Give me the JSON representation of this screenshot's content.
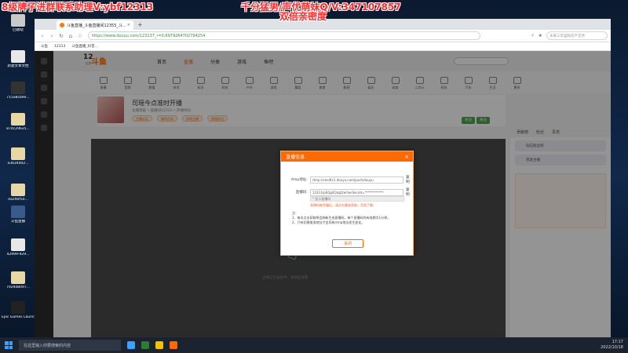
{
  "overlay": {
    "left_banner": "8级牌子进群联系助理V:ybf12313",
    "right_banner_line1": "千分猛男/声优萌妹Q/V:347107857",
    "right_banner_line2": "双倍亲密度"
  },
  "desktop": {
    "icons": [
      {
        "label": "回收站",
        "color": "#c9c9c9"
      },
      {
        "label": "GeForce Expe...",
        "color": "#6bb82c"
      },
      {
        "label": "新建文本文档",
        "color": "#e8e8e8"
      },
      {
        "label": "715a8cb9e...",
        "color": "#333333"
      },
      {
        "label": "874c29635...",
        "color": "#e7d7a6"
      },
      {
        "label": "a3634dd2...",
        "color": "#e7d7a6"
      },
      {
        "label": "ea29ef5e...",
        "color": "#e7d7a6"
      },
      {
        "label": "斗鱼直播",
        "color": "#3a5a8c"
      },
      {
        "label": "42999-929...",
        "color": "#e8e8e8"
      },
      {
        "label": "7929d8097...",
        "color": "#e7d7a6"
      },
      {
        "label": "Epic Games Launcher",
        "color": "#222222"
      }
    ]
  },
  "browser": {
    "tab_title": "斗鱼直播_斗鱼直播间12355_斗...",
    "new_tab": "+",
    "url": "https://www.douyu.com/123137_r=0.6979264702794254",
    "search_placeholder": "未来三年国际房产走势",
    "bookmarks": [
      "斗鱼",
      "12313",
      "斗鱼直播_抖音..."
    ]
  },
  "site": {
    "logo": "斗鱼",
    "nav": [
      "首页",
      "直播",
      "分类",
      "游戏",
      "鱼吧"
    ],
    "category_count": "12",
    "category_count_label": "全部",
    "categories": [
      "直播",
      "音频",
      "颜值",
      "技术",
      "知识",
      "科技",
      "户外",
      "游戏",
      "舞蹈",
      "美食",
      "影视",
      "娱乐",
      "体育",
      "二次元",
      "科技",
      "汽车",
      "生活",
      "更多"
    ],
    "room_title": "司瑶今点准时开播",
    "room_sub": "主播等级 • 直播间12313 • 开播时间",
    "tags": [
      "主播认证",
      "福利活动",
      "游戏主播",
      "颜值担当"
    ],
    "follow_labels": [
      "关注",
      "关注"
    ],
    "player_hint": "主播正在准备中，请稍后观看",
    "right_tabs": [
      "贡献榜",
      "粉丝",
      "贵宾"
    ],
    "right_lines": [
      "钻石粉丝榜",
      "贵族主播"
    ]
  },
  "modal": {
    "title": "直播信息",
    "close": "×",
    "rtmp_label": "rtmp地址:",
    "rtmp_value": "rtmp://sendtc1.douyu.com/push/douyu",
    "copy_label": "复制",
    "key_label": "直播码:",
    "key_value": "12313rpEQg4Qagt2w?wsSecret=************",
    "key_sub": "* 显示直播码",
    "warn": "直播码被泄漏后，请点击重新获取，否则了解",
    "notes_title": "注:",
    "notes": [
      "1、每次点击获取将会刷新生成直播码，每个直播码的有效期为1分钟。",
      "2、只有切换推流地址才会导致rtmp地址发生变化。"
    ],
    "ok_button": "关闭"
  },
  "taskbar": {
    "search": "在这里输入你要搜索的内容",
    "time": "17:17",
    "date": "2022/10/18"
  }
}
